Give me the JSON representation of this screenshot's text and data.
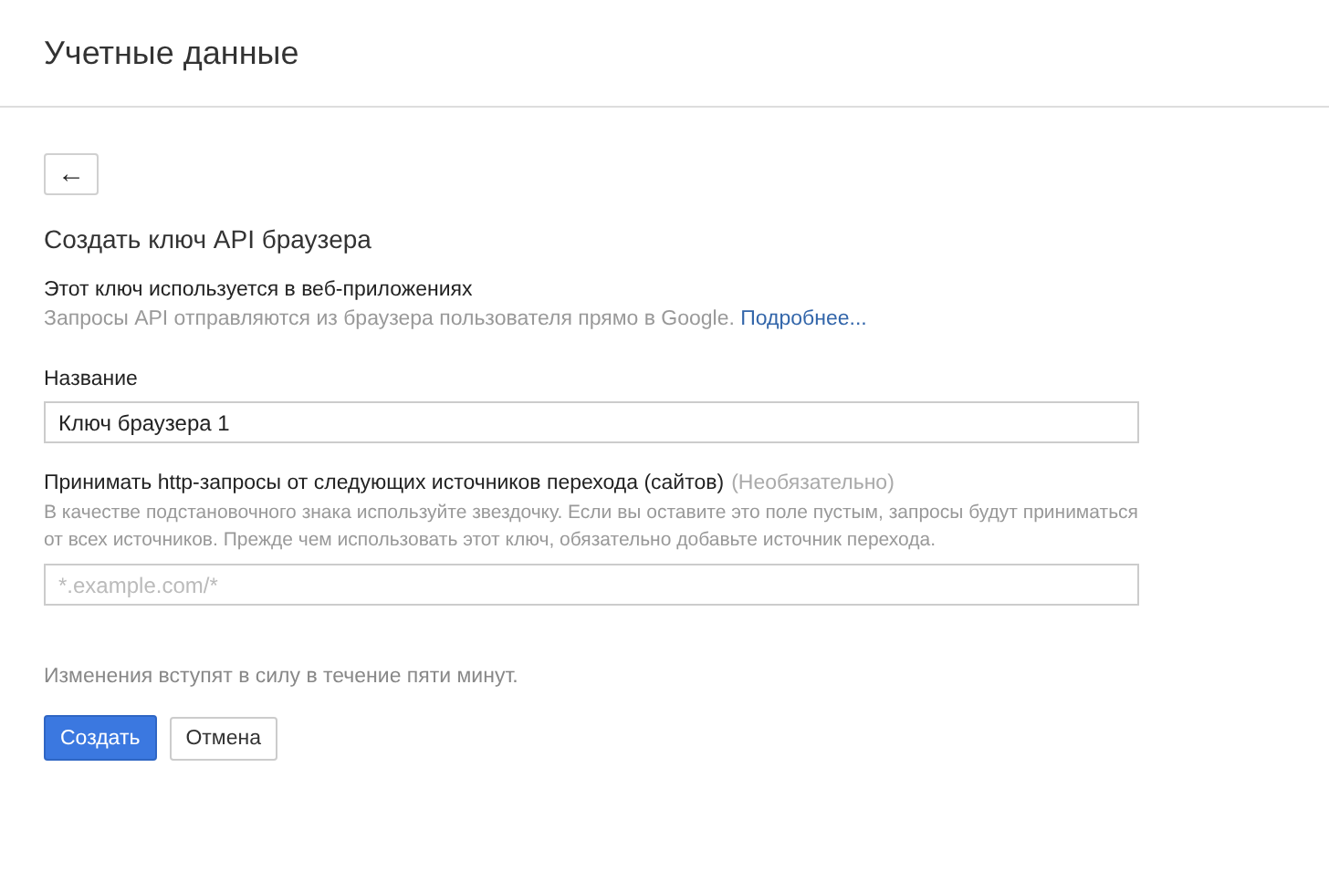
{
  "header": {
    "title": "Учетные данные"
  },
  "back_button": {
    "icon": "←"
  },
  "form": {
    "title": "Создать ключ API браузера",
    "intro": {
      "heading": "Этот ключ используется в веб-приложениях",
      "text": "Запросы API отправляются из браузера пользователя прямо в Google.",
      "link": "Подробнее..."
    },
    "name_field": {
      "label": "Название",
      "value": "Ключ браузера 1"
    },
    "referrers_field": {
      "label": "Принимать http-запросы от следующих источников перехода (сайтов)",
      "optional": "(Необязательно)",
      "hint": "В качестве подстановочного знака используйте звездочку. Если вы оставите это поле пустым, запросы будут приниматься от всех источников. Прежде чем использовать этот ключ, обязательно добавьте источник перехода.",
      "placeholder": "*.example.com/*"
    },
    "note": "Изменения вступят в силу в течение пяти минут.",
    "buttons": [
      {
        "label": "Создать",
        "kind": "primary"
      },
      {
        "label": "Отмена",
        "kind": "secondary"
      }
    ]
  }
}
